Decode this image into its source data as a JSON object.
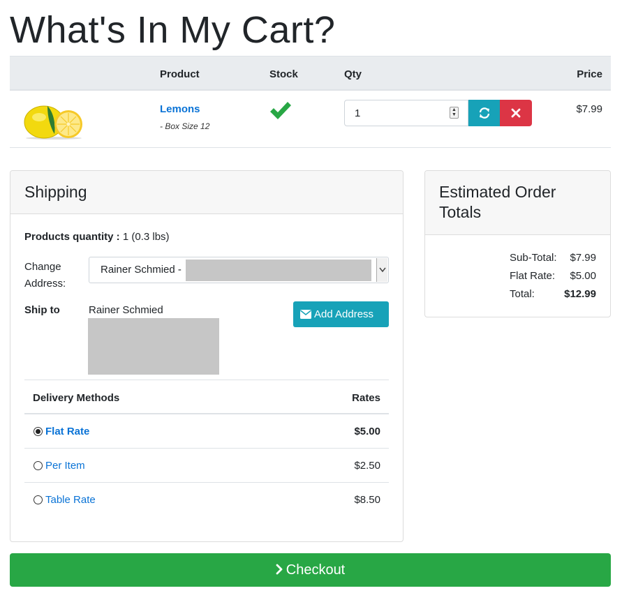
{
  "page": {
    "title": "What's In My Cart?"
  },
  "cart_table": {
    "headers": {
      "image": "",
      "product": "Product",
      "stock": "Stock",
      "qty": "Qty",
      "price": "Price"
    },
    "items": [
      {
        "image_icon": "lemon-image",
        "name": "Lemons",
        "variant": "- Box Size 12",
        "stock_icon": "check-icon",
        "quantity": "1",
        "price": "$7.99"
      }
    ]
  },
  "shipping": {
    "title": "Shipping",
    "products_quantity_label": "Products quantity :",
    "products_quantity_value": "1 (0.3 lbs)",
    "change_address_label": "Change Address:",
    "address_select_value": "Rainer Schmied -",
    "ship_to_label": "Ship to",
    "ship_to_name": "Rainer Schmied",
    "add_address_label": "Add Address",
    "delivery": {
      "method_header": "Delivery Methods",
      "rates_header": "Rates",
      "methods": [
        {
          "name": "Flat Rate",
          "rate": "$5.00",
          "selected": true
        },
        {
          "name": "Per Item",
          "rate": "$2.50",
          "selected": false
        },
        {
          "name": "Table Rate",
          "rate": "$8.50",
          "selected": false
        }
      ]
    }
  },
  "totals": {
    "title": "Estimated Order Totals",
    "rows": [
      {
        "label": "Sub-Total:",
        "value": "$7.99"
      },
      {
        "label": "Flat Rate:",
        "value": "$5.00"
      },
      {
        "label": "Total:",
        "value": "$12.99"
      }
    ]
  },
  "checkout": {
    "label": "Checkout"
  },
  "colors": {
    "link": "#0a73d6",
    "info": "#17a2b8",
    "danger": "#dc3545",
    "success": "#28a745",
    "check": "#28a745"
  }
}
